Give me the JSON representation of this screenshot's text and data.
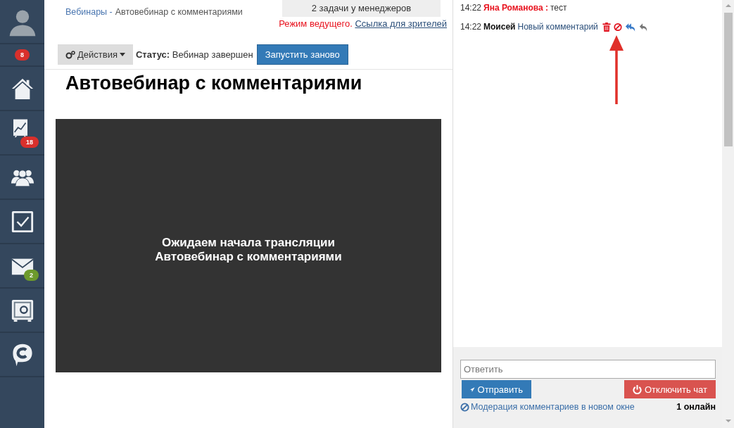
{
  "sidebar": {
    "items": [
      {
        "kind": "avatar"
      },
      {
        "kind": "counter",
        "badge": "8",
        "color": "#d9302c"
      },
      {
        "kind": "home"
      },
      {
        "kind": "chart",
        "badge": "18",
        "color": "#d9302c"
      },
      {
        "kind": "users"
      },
      {
        "kind": "tasks"
      },
      {
        "kind": "mail",
        "badge": "2",
        "color": "#6d9a2c"
      },
      {
        "kind": "safe"
      },
      {
        "kind": "chat"
      }
    ]
  },
  "breadcrumb": {
    "link": "Вебинары -",
    "current": "Автовебинар с комментариями"
  },
  "tasks_notice": "2 задачи у менеджеров",
  "host_mode": {
    "label": "Режим ведущего.",
    "link": "Ссылка для зрителей"
  },
  "toolbar": {
    "actions": "Действия",
    "status_label": "Статус:",
    "status": "Вебинар завершен",
    "restart": "Запустить заново"
  },
  "title": "Автовебинар с комментариями",
  "player": {
    "line_1": "Ожидаем начала трансляции",
    "line_2": "Автовебинар с комментариями"
  },
  "chat": {
    "messages": [
      {
        "time": "14:22",
        "author": "Яна Романова :",
        "color": "#e8101c",
        "text": "тест",
        "actions": false
      },
      {
        "time": "14:22",
        "author": "Моисей",
        "color": "#111111",
        "text": "Новый комментарий",
        "actions": true
      }
    ],
    "reply_placeholder": "Ответить",
    "send": "Отправить",
    "disable": "Отключить чат",
    "moderation_link": "Модерация комментариев в новом окне",
    "online": "1 онлайн"
  }
}
